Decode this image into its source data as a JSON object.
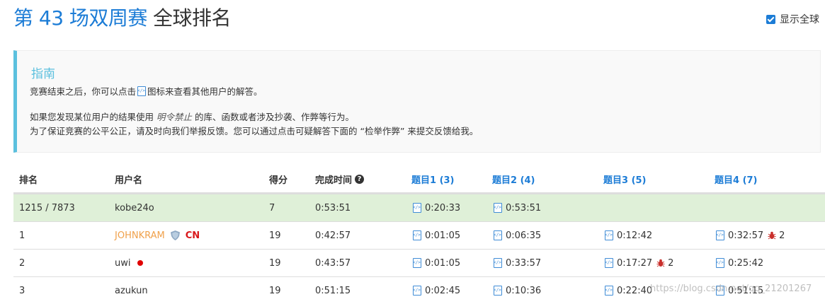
{
  "header": {
    "contest": "第 43 场双周赛",
    "rank_word": "全球排名",
    "toggle_label": "显示全球",
    "toggle_checked": true
  },
  "guide": {
    "title": "指南",
    "line1_a": "竞赛结束之后，你可以点击",
    "line1_b": "图标来查看其他用户的解答。",
    "line2_a": "如果您发现某位用户的结果使用",
    "line2_em": "明令禁止",
    "line2_b": "的库、函数或者涉及抄袭、作弊等行为。",
    "line3": "为了保证竞赛的公平公正，请及时向我们举报反馈。您可以通过点击可疑解答下面的 “检举作弊” 来提交反馈给我。"
  },
  "table": {
    "headers": {
      "rank": "排名",
      "user": "用户名",
      "score": "得分",
      "finish_time": "完成时间",
      "q1": "题目1 (3)",
      "q2": "题目2 (4)",
      "q3": "题目3 (5)",
      "q4": "题目4 (7)"
    },
    "rows": [
      {
        "rank": "1215 / 7873",
        "user": "kobe24o",
        "score": "7",
        "time": "0:53:51",
        "q1": "0:20:33",
        "q2": "0:53:51",
        "q3": "",
        "q4": "",
        "q4_bugs": ""
      },
      {
        "rank": "1",
        "user": "JOHNKRAM",
        "badge": "CN",
        "score": "19",
        "time": "0:42:57",
        "q1": "0:01:05",
        "q2": "0:06:35",
        "q3": "0:12:42",
        "q4": "0:32:57",
        "q4_bugs": "2"
      },
      {
        "rank": "2",
        "user": "uwi",
        "score": "19",
        "time": "0:43:57",
        "q1": "0:01:05",
        "q2": "0:33:57",
        "q3": "0:17:27",
        "q3_bugs": "2",
        "q4": "0:25:42"
      },
      {
        "rank": "3",
        "user": "azukun",
        "score": "19",
        "time": "0:51:15",
        "q1": "0:02:45",
        "q2": "0:10:36",
        "q3": "0:22:40",
        "q4": "0:51:15"
      }
    ]
  },
  "watermark": "https://blog.csdn.net/qq_21201267",
  "colors": {
    "brand_blue": "#1c7cd6",
    "guide_accent": "#5bc0de",
    "my_row_bg": "#dff0d8",
    "rank1_name": "#f0a14b",
    "cn_badge": "#d9171a"
  }
}
